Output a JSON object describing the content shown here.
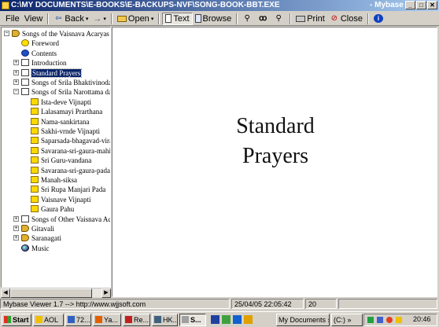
{
  "window": {
    "title_path": "C:\\MY DOCUMENTS\\E-BOOKS\\E-BACKUPS-NVF\\SONG-BOOK-BBT.EXE",
    "app_name": "- Mybase Viewer",
    "controls": [
      "_",
      "□",
      "✕"
    ]
  },
  "menu": {
    "file": "File",
    "view": "View"
  },
  "toolbar": {
    "back": "Back",
    "forward": "→",
    "open": "Open",
    "text": "Text",
    "browse": "Browse",
    "print": "Print",
    "close": "Close"
  },
  "tree": [
    {
      "label": "Songs of the Vaisnava Acaryas",
      "icon": "speaker-icon",
      "expander": "−"
    },
    {
      "label": "Foreword",
      "icon": "smiley-icon"
    },
    {
      "label": "Contents",
      "icon": "help-icon"
    },
    {
      "label": "Introduction",
      "icon": "document-icon",
      "expander": "+"
    },
    {
      "label": "Standard Prayers",
      "icon": "document-icon",
      "expander": "+",
      "selected": true
    },
    {
      "label": "Songs of Srila Bhaktivinoda T",
      "icon": "document-icon",
      "expander": "+"
    },
    {
      "label": "Songs of Srila Narottama das",
      "icon": "document-icon",
      "expander": "−"
    },
    {
      "label": "Ista-deve Vijnapti",
      "icon": "book-icon"
    },
    {
      "label": "Lalasamayi Prarthana",
      "icon": "book-icon"
    },
    {
      "label": "Nama-sankirtana",
      "icon": "book-icon"
    },
    {
      "label": "Sakhi-vrnde Vijnapti",
      "icon": "book-icon"
    },
    {
      "label": "Saparsada-bhagavad-vira",
      "icon": "book-icon"
    },
    {
      "label": "Savarana-sri-gaura-mahir",
      "icon": "book-icon"
    },
    {
      "label": "Sri Guru-vandana",
      "icon": "book-icon"
    },
    {
      "label": "Savarana-sri-gaura-pada-",
      "icon": "book-icon"
    },
    {
      "label": "Manah-siksa",
      "icon": "book-icon"
    },
    {
      "label": "Sri Rupa Manjari Pada",
      "icon": "book-icon"
    },
    {
      "label": "Vaisnave Vijnapti",
      "icon": "book-icon"
    },
    {
      "label": "Gaura Pahu",
      "icon": "book-icon"
    },
    {
      "label": "Songs of Other Vaisnava Acı",
      "icon": "document-icon",
      "expander": "+"
    },
    {
      "label": "Gitavali",
      "icon": "speaker-icon",
      "expander": "+"
    },
    {
      "label": "Saranagati",
      "icon": "speaker-icon",
      "expander": "+"
    },
    {
      "label": "Music",
      "icon": "globe-icon"
    }
  ],
  "content": {
    "heading_line1": "Standard",
    "heading_line2": "Prayers"
  },
  "status": {
    "app": "Mybase Viewer 1.7  -->  http://www.wjjsoft.com",
    "datetime": "25/04/05 22:05:42",
    "count": "20"
  },
  "taskbar": {
    "start": "Start",
    "tasks": [
      "AOL",
      "72...",
      "Ya...",
      "Re...",
      "HK...",
      "S..."
    ],
    "documents": "My Documents",
    "drive": "(C:)",
    "clock": "20:46"
  }
}
